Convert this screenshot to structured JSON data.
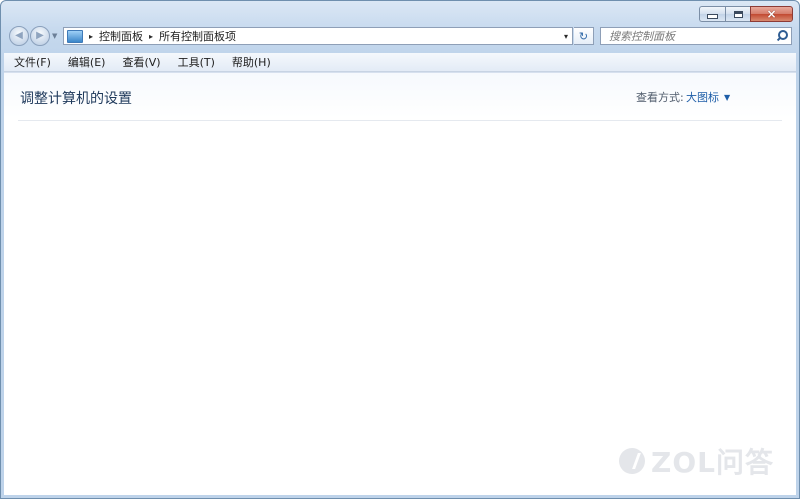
{
  "window": {
    "controls": {
      "minimize": "minimize",
      "maximize": "maximize",
      "close": "×"
    }
  },
  "navigation": {
    "back_icon": "back-arrow-icon",
    "forward_icon": "forward-arrow-icon"
  },
  "address_bar": {
    "breadcrumbs": [
      "控制面板",
      "所有控制面板项"
    ],
    "separator": "▸",
    "dropdown": "▾",
    "refresh": "↻"
  },
  "search": {
    "placeholder": "搜索控制面板"
  },
  "menu": {
    "items": [
      "文件(F)",
      "编辑(E)",
      "查看(V)",
      "工具(T)",
      "帮助(H)"
    ]
  },
  "content": {
    "title": "调整计算机的设置",
    "view_label": "查看方式:",
    "view_value": "大图标",
    "view_dropdown": "▼"
  },
  "watermark": {
    "text": "ZOL问答"
  },
  "colors": {
    "title_text": "#1e395b",
    "link_blue": "#1e5ea8",
    "frame": "#bed3ea"
  }
}
